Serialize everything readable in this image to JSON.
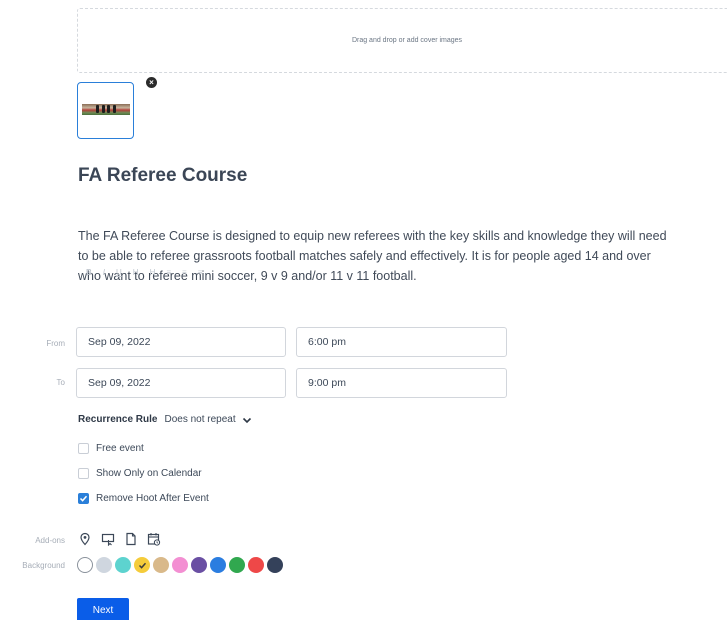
{
  "cover": {
    "dropzone_text": "Drag and drop or add cover images",
    "remove_label": "×"
  },
  "event": {
    "title": "FA Referee Course",
    "description_lines": [
      "The FA Referee Course is designed to equip new referees with the key skills and knowledge they will need",
      "to be able to referee grassroots football matches safely and effectively.  It is for people aged 14 and over",
      "who want to referee mini soccer, 9 v 9 and/or 11 v 11 football."
    ]
  },
  "format_bar": [
    "B",
    "I",
    "U",
    "H",
    "H",
    "≡",
    "≡",
    "≡"
  ],
  "from": {
    "label": "From",
    "date": "Sep 09, 2022",
    "time": "6:00 pm"
  },
  "to": {
    "label": "To",
    "date": "Sep 09, 2022",
    "time": "9:00 pm"
  },
  "recurrence": {
    "label": "Recurrence Rule",
    "value": "Does not repeat"
  },
  "options": [
    {
      "label": "Free event",
      "checked": false
    },
    {
      "label": "Show Only on Calendar",
      "checked": false
    },
    {
      "label": "Remove Hoot After Event",
      "checked": true
    }
  ],
  "addons": {
    "label": "Add-ons",
    "icons": [
      "location-pin-icon",
      "screen-cursor-icon",
      "document-icon",
      "calendar-clock-icon"
    ]
  },
  "background": {
    "label": "Background",
    "colors": [
      "#ffffff",
      "#cfd6df",
      "#5dd3cf",
      "#f5cc3b",
      "#d9b98a",
      "#f38fd2",
      "#6a4fa3",
      "#2b7de0",
      "#31a84f",
      "#ee4848",
      "#34415a"
    ],
    "selected_index": 3
  },
  "next_button": "Next"
}
